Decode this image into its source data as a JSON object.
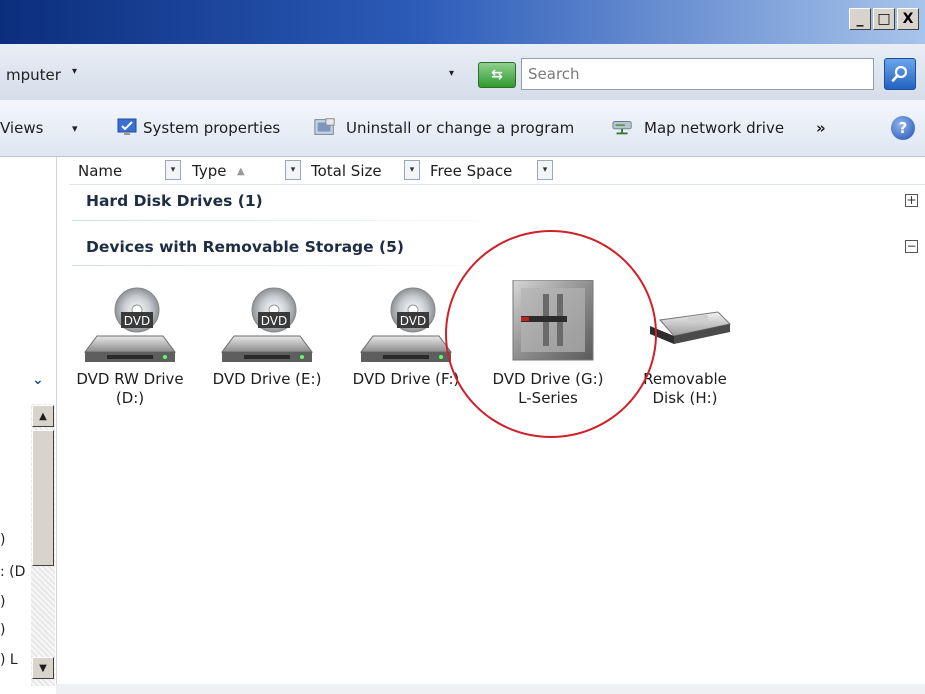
{
  "window": {
    "minimize_label": "_",
    "maximize_label": "□",
    "close_label": "X"
  },
  "address": {
    "path_text": "mputer",
    "dropdown_glyph": "▾",
    "history_glyph": "▾",
    "search_placeholder": "Search"
  },
  "toolbar": {
    "views_label": "Views",
    "views_dropdown": "▾",
    "system_properties": "System properties",
    "uninstall": "Uninstall or change a program",
    "map_network": "Map network drive",
    "more": "»",
    "help": "?"
  },
  "columns": [
    {
      "label": "Name"
    },
    {
      "label": "Type"
    },
    {
      "label": "Total Size"
    },
    {
      "label": "Free Space"
    }
  ],
  "groups": {
    "hard_disk": {
      "title": "Hard Disk Drives (1)",
      "toggle": "+"
    },
    "removable": {
      "title": "Devices with Removable Storage (5)",
      "toggle": "−"
    }
  },
  "drives": [
    {
      "line1": "DVD RW Drive",
      "line2": "(D:)",
      "badge": "DVD",
      "icon": "dvd-drive-icon"
    },
    {
      "line1": "DVD Drive (E:)",
      "line2": "",
      "badge": "DVD",
      "icon": "dvd-drive-icon"
    },
    {
      "line1": "DVD Drive (F:)",
      "line2": "",
      "badge": "DVD",
      "icon": "dvd-drive-icon"
    },
    {
      "line1": "DVD Drive (G:)",
      "line2": "L-Series",
      "badge": "",
      "icon": "disc-label-image-icon"
    },
    {
      "line1": "Removable",
      "line2": "Disk (H:)",
      "badge": "",
      "icon": "removable-disk-icon"
    }
  ],
  "left_pane": {
    "chevron": "⌄",
    "fragments": [
      ")",
      ": (D",
      ")",
      ")",
      ") L"
    ]
  },
  "colors": {
    "title_dark": "#0b2e7c",
    "highlight_circle": "#d0202a",
    "group_title": "#1e2d44"
  }
}
